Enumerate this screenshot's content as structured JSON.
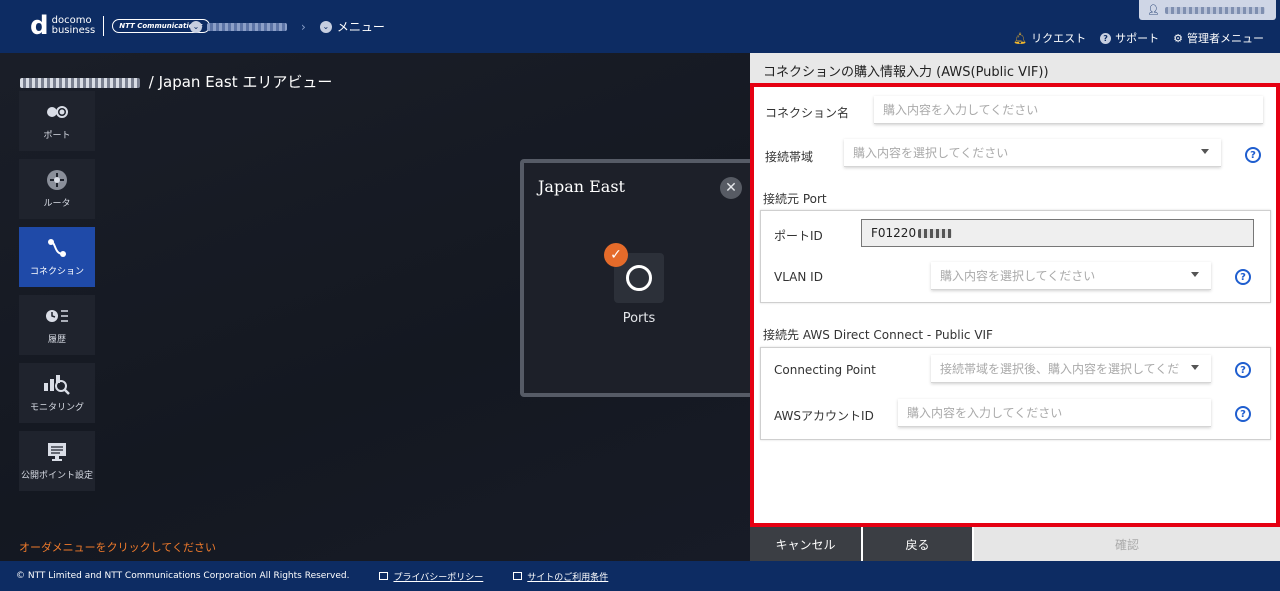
{
  "header": {
    "logo_top": "docomo",
    "logo_bottom": "business",
    "partner_logo": "NTT Communications",
    "breadcrumb_tenant": "",
    "breadcrumb_menu": "メニュー",
    "links": {
      "request": "リクエスト",
      "support": "サポート",
      "admin_menu": "管理者メニュー"
    }
  },
  "area": {
    "title_suffix": "/ Japan East エリアビュー",
    "order_hint": "オーダメニューをクリックしてください"
  },
  "sidebar": {
    "items": [
      {
        "label": "ポート",
        "icon": "port-icon"
      },
      {
        "label": "ルータ",
        "icon": "router-icon"
      },
      {
        "label": "コネクション",
        "icon": "connection-icon"
      },
      {
        "label": "履歴",
        "icon": "history-icon"
      },
      {
        "label": "モニタリング",
        "icon": "monitoring-icon"
      },
      {
        "label": "公開ポイント設定",
        "icon": "public-point-icon"
      }
    ],
    "active_index": 2
  },
  "region_card": {
    "title": "Japan East",
    "tile_label": "Ports"
  },
  "panel": {
    "title": "コネクションの購入情報入力 (AWS(Public VIF))",
    "connection_name": {
      "label": "コネクション名",
      "placeholder": "購入内容を入力してください",
      "value": ""
    },
    "bandwidth": {
      "label": "接続帯域",
      "placeholder": "購入内容を選択してください"
    },
    "source_section": "接続元 Port",
    "port_id": {
      "label": "ポートID",
      "value": "F01220"
    },
    "vlan_id": {
      "label": "VLAN ID",
      "placeholder": "購入内容を選択してください"
    },
    "dest_section": "接続先 AWS Direct Connect - Public VIF",
    "connecting_point": {
      "label": "Connecting Point",
      "placeholder": "接続帯域を選択後、購入内容を選択してくだ"
    },
    "aws_account": {
      "label": "AWSアカウントID",
      "placeholder": "購入内容を入力してください",
      "value": ""
    },
    "actions": {
      "cancel": "キャンセル",
      "back": "戻る",
      "confirm": "確認"
    }
  },
  "footer": {
    "copyright": "© NTT Limited and NTT Communications Corporation All Rights Reserved.",
    "privacy": "プライバシーポリシー",
    "terms": "サイトのご利用条件"
  },
  "colors": {
    "header_bg": "#0d2c63",
    "active_nav": "#1f4aa8",
    "highlight_border": "#e50012",
    "accent_orange": "#e56b2a",
    "help_blue": "#1f5ecf"
  }
}
